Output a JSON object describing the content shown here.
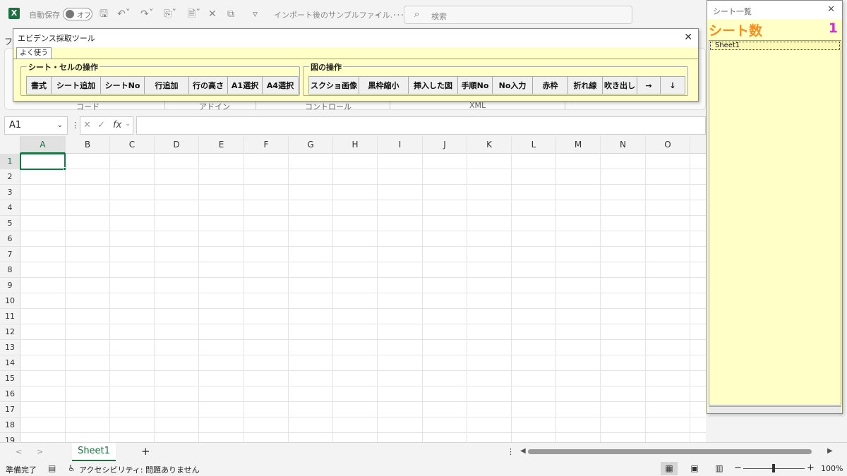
{
  "titlebar": {
    "app_icon": "X",
    "autosave_label": "自動保存",
    "toggle_state": "オフ",
    "filename": "インポート後のサンプルファイル.･･･",
    "search_placeholder": "検索"
  },
  "ribbon": {
    "hidden_tab_letter": "フ",
    "group_labels": [
      "コード",
      "アドイン",
      "コントロール",
      "XML"
    ]
  },
  "tool_window": {
    "title": "エビデンス採取ツール",
    "tab": "よく使う",
    "group1": {
      "label": "シート・セルの操作",
      "buttons": [
        "書式",
        "シート追加",
        "シートNo",
        "行追加",
        "行の高さ",
        "A1選択",
        "A4選択"
      ]
    },
    "group2": {
      "label": "図の操作",
      "buttons": [
        "スクショ画像",
        "黒枠縮小",
        "挿入した図",
        "手順No",
        "No入力",
        "赤枠",
        "折れ線",
        "吹き出し",
        "→",
        "↓"
      ]
    }
  },
  "formula_bar": {
    "name_box": "A1",
    "value": ""
  },
  "grid": {
    "columns": [
      "A",
      "B",
      "C",
      "D",
      "E",
      "F",
      "G",
      "H",
      "I",
      "J",
      "K",
      "L",
      "M",
      "N",
      "O"
    ],
    "rows": [
      "1",
      "2",
      "3",
      "4",
      "5",
      "6",
      "7",
      "8",
      "9",
      "10",
      "11",
      "12",
      "13",
      "14",
      "15",
      "16",
      "17",
      "18",
      "19"
    ],
    "active_cell": "A1"
  },
  "sheet_tabs": {
    "tabs": [
      "Sheet1"
    ],
    "active": "Sheet1"
  },
  "status": {
    "ready": "準備完了",
    "accessibility": "アクセシビリティ: 問題ありません",
    "zoom": "100%"
  },
  "sheet_panel": {
    "title": "シート一覧",
    "count_label": "シート数",
    "count_value": "1",
    "sheets": [
      "Sheet1"
    ]
  },
  "colors": {
    "excel_green": "#1d6f42",
    "panel_yellow": "#ffffc8",
    "count_orange": "#ff8c1a",
    "count_magenta": "#e81fe8"
  }
}
